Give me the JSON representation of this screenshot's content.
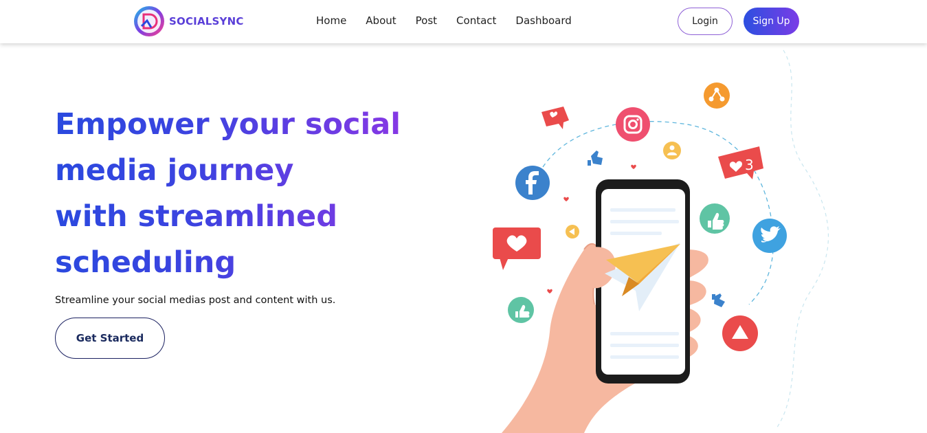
{
  "brand": {
    "name": "SOCIALSYNC",
    "logo_icon": "brand-logo-icon"
  },
  "nav": {
    "links": [
      "Home",
      "About",
      "Post",
      "Contact",
      "Dashboard"
    ]
  },
  "auth": {
    "login_label": "Login",
    "signup_label": "Sign Up"
  },
  "hero": {
    "title_lines": [
      "Empower your social",
      "media journey",
      "with streamlined",
      "scheduling"
    ],
    "subtitle": "Streamline your social medias post and content with us.",
    "cta_label": "Get Started"
  },
  "illustration": {
    "badge_count": "3",
    "icons": [
      "instagram-icon",
      "facebook-icon",
      "twitter-icon",
      "share-icon",
      "like-icon",
      "heart-icon",
      "user-icon",
      "play-icon",
      "paper-plane-icon",
      "smartphone-icon",
      "hand-icon"
    ]
  },
  "colors": {
    "accent_blue": "#2a49df",
    "accent_purple": "#8a37e5",
    "instagram": "#ef4f6f",
    "facebook": "#3b82cc",
    "twitter": "#3fa2e0",
    "share": "#f59a2f",
    "like_green": "#5fc4a4",
    "heart_red": "#ea4b4b",
    "plane_yellow": "#f6c052"
  }
}
